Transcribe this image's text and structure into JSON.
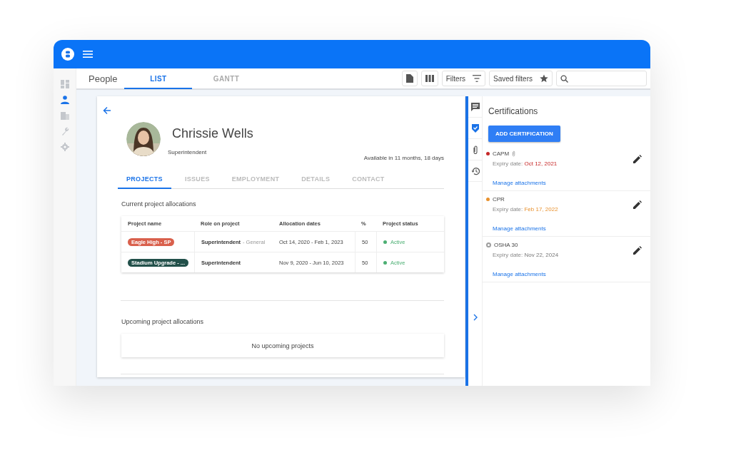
{
  "rail": [
    {
      "kind": "dashboard",
      "selected": false
    },
    {
      "kind": "person",
      "selected": true
    },
    {
      "kind": "building",
      "selected": false
    },
    {
      "kind": "wrench",
      "selected": false
    },
    {
      "kind": "gear",
      "selected": false
    }
  ],
  "page_title": "People",
  "view_tabs": [
    {
      "label": "LIST",
      "selected": true
    },
    {
      "label": "GANTT",
      "selected": false
    }
  ],
  "toolbar": {
    "filters": "Filters",
    "saved_filters": "Saved filters"
  },
  "profile": {
    "name": "Chrissie Wells",
    "title": "Superintendent",
    "availability": "Available in 11 months, 18 days"
  },
  "profile_tabs": [
    {
      "label": "PROJECTS",
      "selected": true
    },
    {
      "label": "ISSUES",
      "selected": false
    },
    {
      "label": "EMPLOYMENT",
      "selected": false
    },
    {
      "label": "DETAILS",
      "selected": false
    },
    {
      "label": "CONTACT",
      "selected": false
    }
  ],
  "current": {
    "heading": "Current project allocations",
    "columns": [
      "Project name",
      "Role on project",
      "Allocation dates",
      "%",
      "Project status"
    ],
    "rows": [
      {
        "project": "Eagle High - SP",
        "color": "#d9604c",
        "role": "Superintendent",
        "role_note": "- General",
        "dates": "Oct 14, 2020 - Feb 1, 2023",
        "percent": "50",
        "status": "Active"
      },
      {
        "project": "Stadium Upgrade - ...",
        "color": "#22504a",
        "role": "Superintendent",
        "dates": "Nov 9, 2020 - Jun 10, 2023",
        "percent": "50",
        "status": "Active"
      }
    ]
  },
  "upcoming": {
    "heading": "Upcoming project allocations",
    "empty": "No upcoming projects"
  },
  "panel_icons": [
    {
      "kind": "comment",
      "selected": false
    },
    {
      "kind": "shield",
      "selected": true
    },
    {
      "kind": "clip",
      "selected": false
    },
    {
      "kind": "history",
      "selected": false
    }
  ],
  "certifications": {
    "title": "Certifications",
    "add_button": "ADD CERTIFICATION",
    "items": [
      {
        "name": "CAPM",
        "attachment": true,
        "expiry_label": "Expiry date:",
        "expiry": "Oct 12, 2021",
        "kind": "filled",
        "color": "#c62828",
        "link": "Manage attachments"
      },
      {
        "name": "CPR",
        "attachment": false,
        "expiry_label": "Expiry date:",
        "expiry": "Feb 17, 2022",
        "kind": "filled",
        "color": "#e8912d",
        "link": "Manage attachments"
      },
      {
        "name": "OSHA 30",
        "attachment": false,
        "expiry_label": "Expiry date:",
        "expiry": "Nov 22, 2024",
        "kind": "outline",
        "color": "#9e9e9e",
        "link": "Manage attachments"
      }
    ]
  }
}
